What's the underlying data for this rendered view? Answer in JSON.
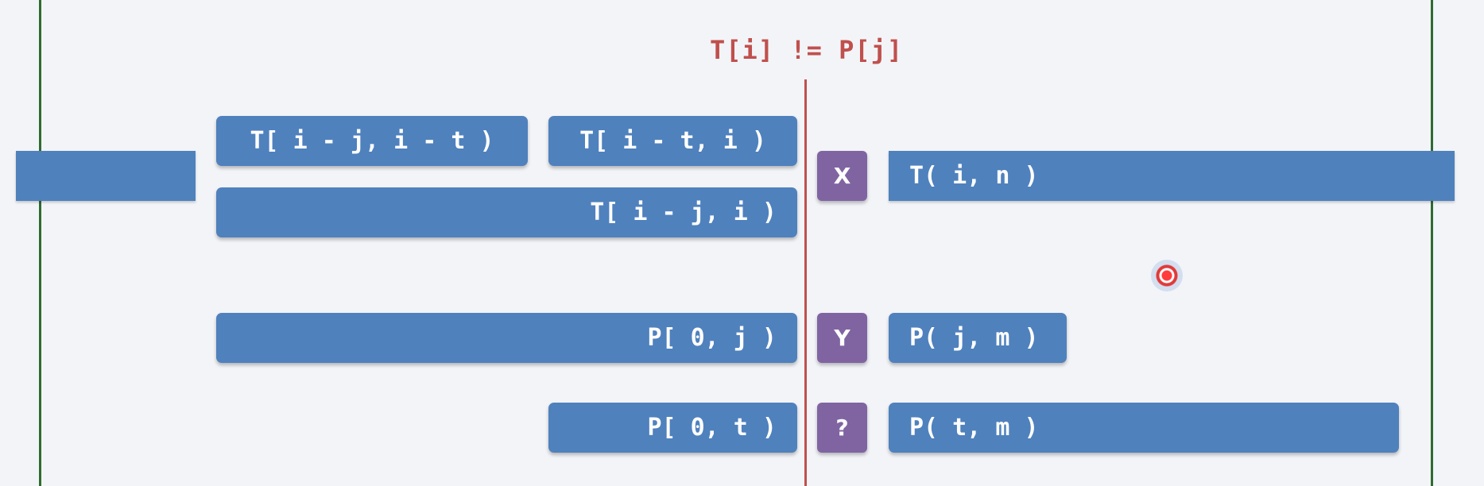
{
  "heading": "T[i] != P[j]",
  "left_segments": {
    "t_i_minus_j_to_i_minus_t": "T[ i - j, i - t )",
    "t_i_minus_t_to_i": "T[ i - t, i )",
    "t_i_minus_j_to_i": "T[ i - j, i )",
    "p_0_to_j": "P[ 0, j )",
    "p_0_to_t": "P[ 0, t )"
  },
  "markers": {
    "x": "X",
    "y": "Y",
    "question": "?"
  },
  "right_segments": {
    "t_i_to_n": "T( i, n )",
    "p_j_to_m": "P( j, m )",
    "p_t_to_m": "P( t, m )"
  },
  "colors": {
    "segment": "#4f81bd",
    "marker": "#8064a2",
    "accent": "#c0504d",
    "frame": "#2f6b2f",
    "background": "#f2f4f8"
  }
}
